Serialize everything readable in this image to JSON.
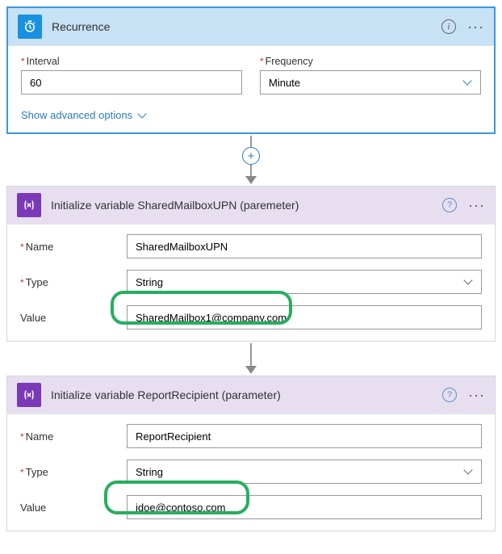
{
  "recurrence": {
    "title": "Recurrence",
    "interval_label": "Interval",
    "interval_value": "60",
    "frequency_label": "Frequency",
    "frequency_value": "Minute",
    "advanced_label": "Show advanced options"
  },
  "var1": {
    "title": "Initialize variable SharedMailboxUPN (paremeter)",
    "name_label": "Name",
    "name_value": "SharedMailboxUPN",
    "type_label": "Type",
    "type_value": "String",
    "value_label": "Value",
    "value_value": "SharedMailbox1@company.com"
  },
  "var2": {
    "title": "Initialize variable ReportRecipient (parameter)",
    "name_label": "Name",
    "name_value": "ReportRecipient",
    "type_label": "Type",
    "type_value": "String",
    "value_label": "Value",
    "value_value": "jdoe@contoso.com"
  },
  "icons": {
    "info": "i",
    "help": "?",
    "more": "···",
    "plus": "+"
  }
}
